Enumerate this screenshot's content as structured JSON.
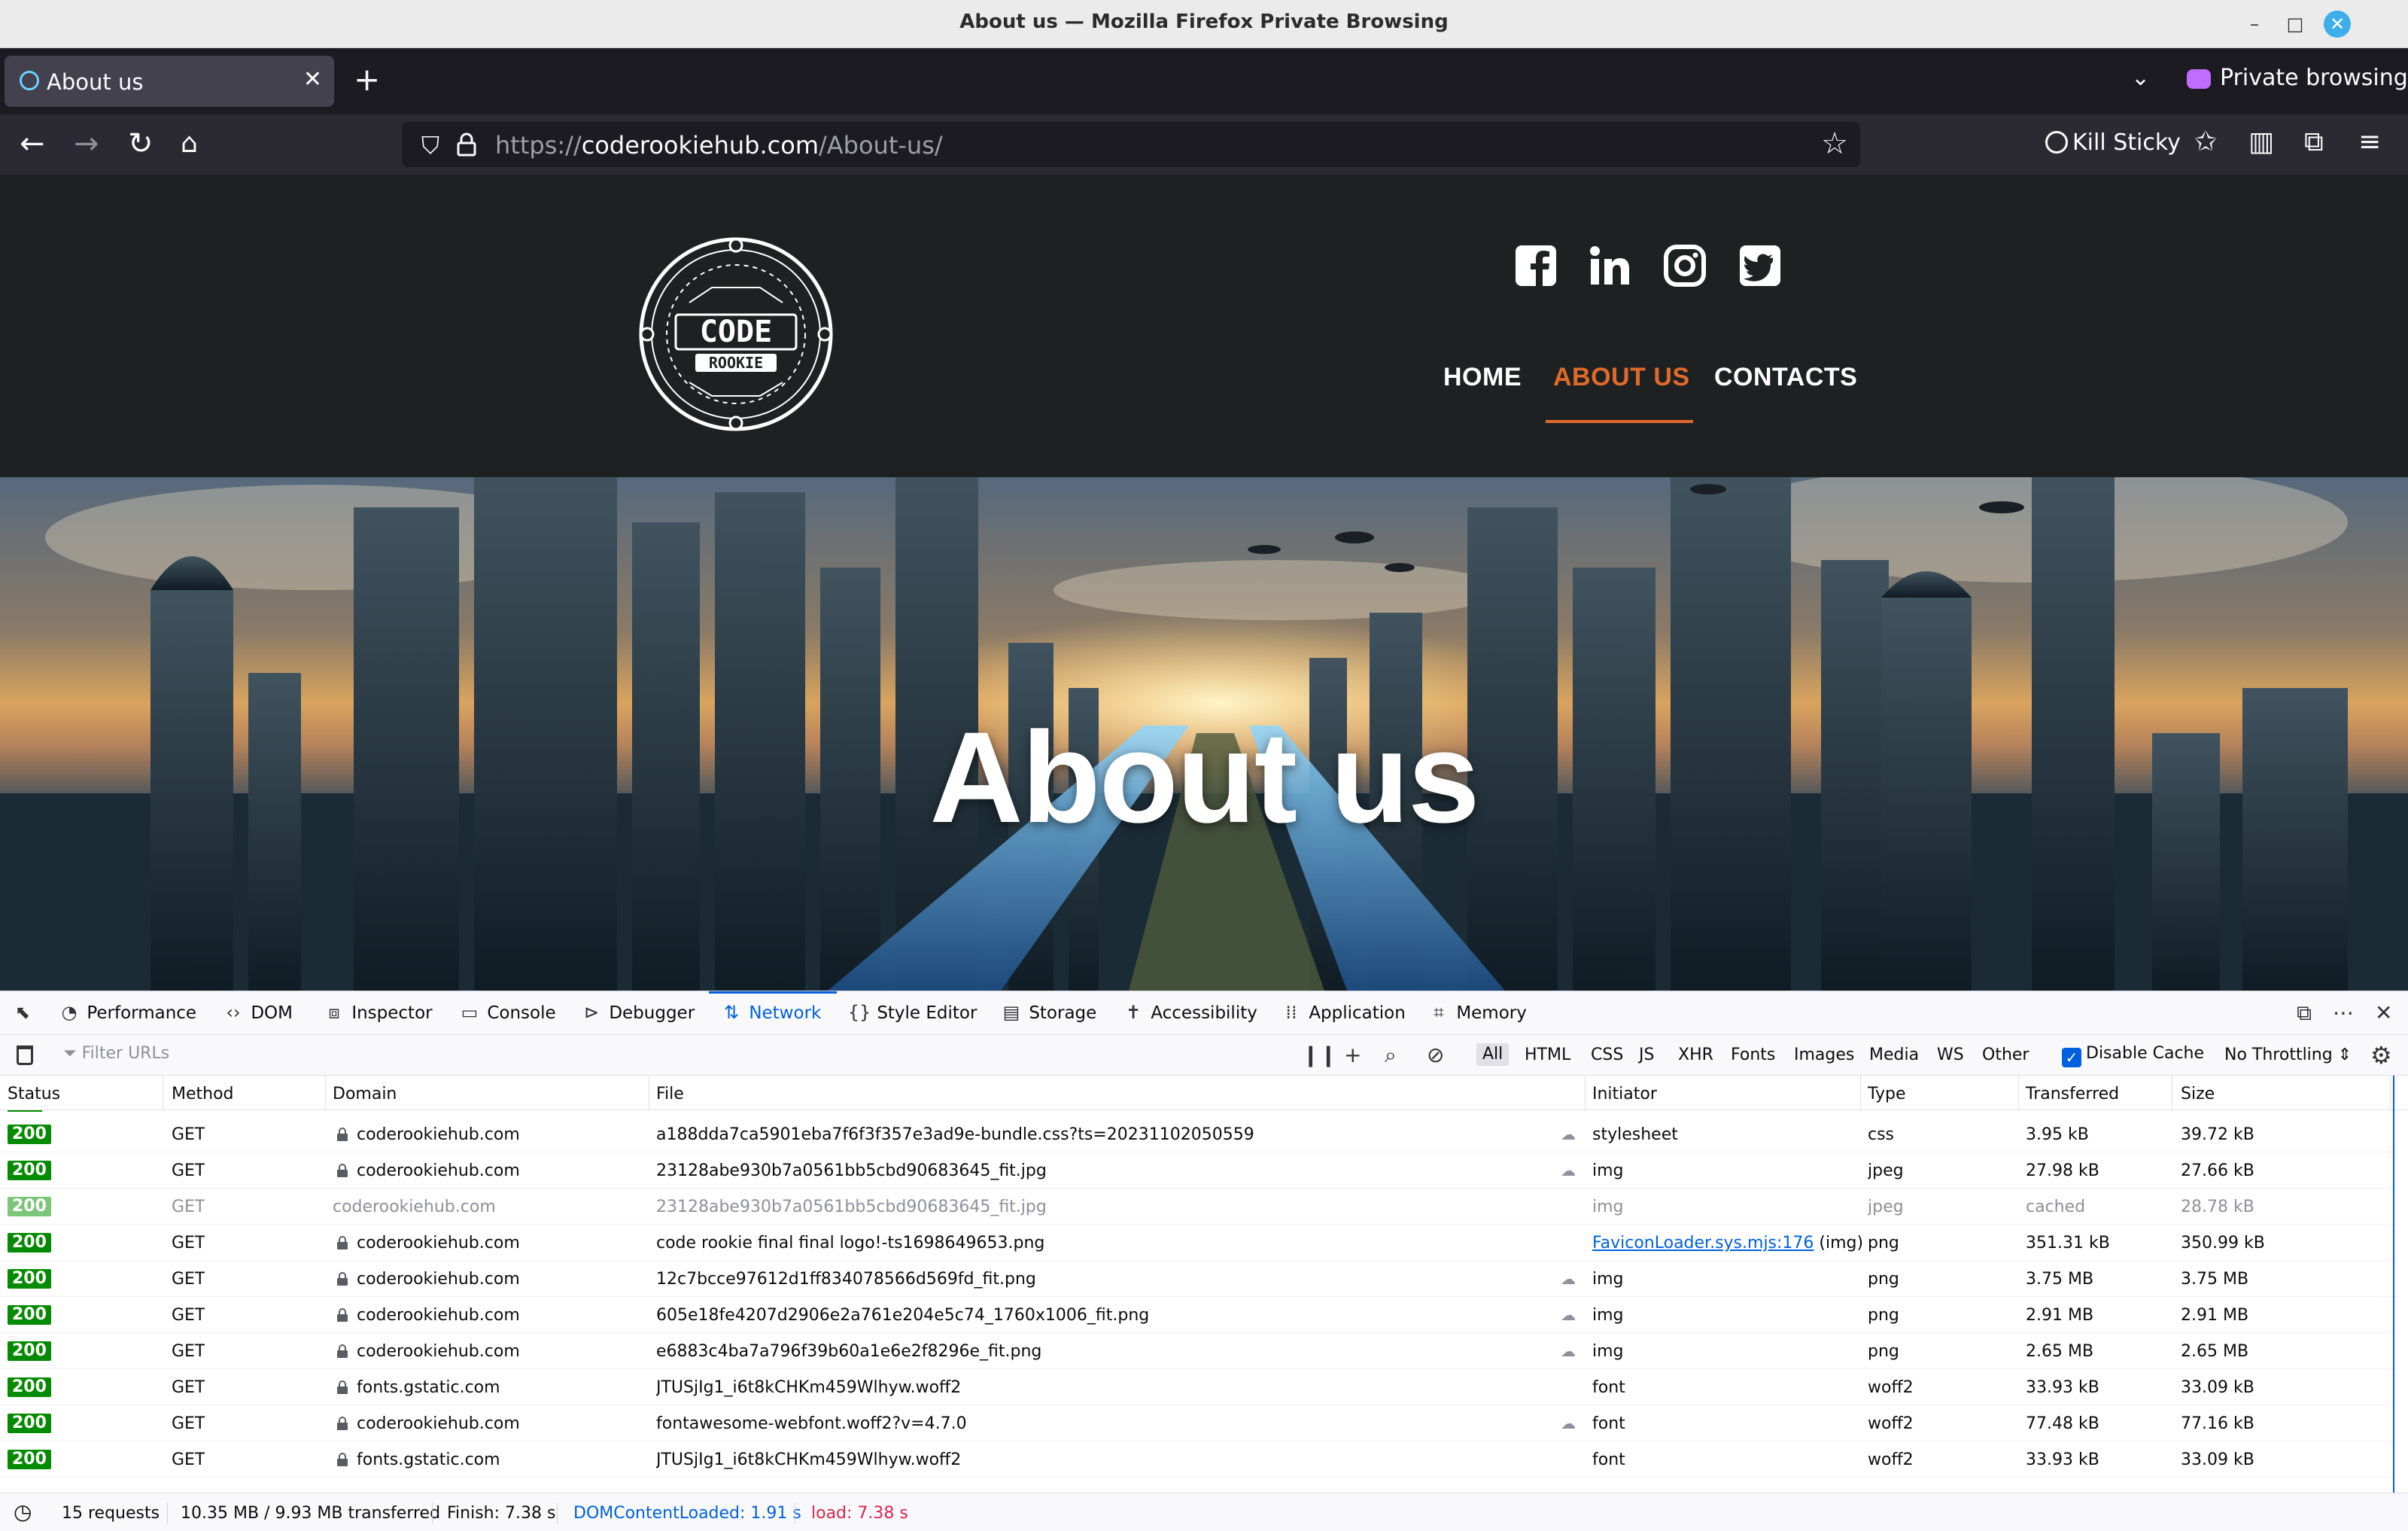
{
  "window": {
    "title": "About us — Mozilla Firefox Private Browsing"
  },
  "tabs": [
    {
      "label": "About us",
      "active": true
    }
  ],
  "toolbar": {
    "private_label": "Private browsing",
    "kill_sticky_label": "Kill Sticky"
  },
  "urlbar": {
    "scheme": "https://",
    "host": "coderookiehub.com",
    "path": "/About-us/"
  },
  "site": {
    "logo_text": "CODE ROOKIE",
    "nav": [
      {
        "label": "HOME",
        "active": false
      },
      {
        "label": "ABOUT US",
        "active": true
      },
      {
        "label": "CONTACTS",
        "active": false
      }
    ],
    "social_icons": [
      "facebook-icon",
      "linkedin-icon",
      "instagram-icon",
      "twitter-icon"
    ],
    "hero_title": "About us",
    "accent_color": "#e06a2b"
  },
  "devtools": {
    "tabs": [
      "Performance",
      "DOM",
      "Inspector",
      "Console",
      "Debugger",
      "Network",
      "Style Editor",
      "Storage",
      "Accessibility",
      "Application",
      "Memory"
    ],
    "active_tab": "Network",
    "filter_placeholder": "Filter URLs",
    "filter_types": [
      "All",
      "HTML",
      "CSS",
      "JS",
      "XHR",
      "Fonts",
      "Images",
      "Media",
      "WS",
      "Other"
    ],
    "disable_cache_label": "Disable Cache",
    "disable_cache_checked": true,
    "throttling_label": "No Throttling",
    "columns": [
      "Status",
      "Method",
      "Domain",
      "File",
      "Initiator",
      "Type",
      "Transferred",
      "Size"
    ],
    "rows": [
      {
        "status": "200",
        "method": "GET",
        "domain": "coderookiehub.com",
        "secure": true,
        "file": "a188dda7ca5901eba7f6f3f357e3ad9e-bundle.css?ts=20231102050559",
        "tracker": true,
        "initiator": "stylesheet",
        "type": "css",
        "transferred": "3.95 kB",
        "size": "39.72 kB",
        "cached": false
      },
      {
        "status": "200",
        "method": "GET",
        "domain": "coderookiehub.com",
        "secure": true,
        "file": "23128abe930b7a0561bb5cbd90683645_fit.jpg",
        "tracker": true,
        "initiator": "img",
        "type": "jpeg",
        "transferred": "27.98 kB",
        "size": "27.66 kB",
        "cached": false
      },
      {
        "status": "200",
        "method": "GET",
        "domain": "coderookiehub.com",
        "secure": false,
        "file": "23128abe930b7a0561bb5cbd90683645_fit.jpg",
        "tracker": false,
        "initiator": "img",
        "type": "jpeg",
        "transferred": "cached",
        "size": "28.78 kB",
        "cached": true
      },
      {
        "status": "200",
        "method": "GET",
        "domain": "coderookiehub.com",
        "secure": true,
        "file": "code rookie final final logo!-ts1698649653.png",
        "tracker": false,
        "initiator": "FaviconLoader.sys.mjs:176",
        "initiator_suffix": "(img)",
        "type": "png",
        "transferred": "351.31 kB",
        "size": "350.99 kB",
        "cached": false
      },
      {
        "status": "200",
        "method": "GET",
        "domain": "coderookiehub.com",
        "secure": true,
        "file": "12c7bcce97612d1ff834078566d569fd_fit.png",
        "tracker": true,
        "initiator": "img",
        "type": "png",
        "transferred": "3.75 MB",
        "size": "3.75 MB",
        "cached": false
      },
      {
        "status": "200",
        "method": "GET",
        "domain": "coderookiehub.com",
        "secure": true,
        "file": "605e18fe4207d2906e2a761e204e5c74_1760x1006_fit.png",
        "tracker": true,
        "initiator": "img",
        "type": "png",
        "transferred": "2.91 MB",
        "size": "2.91 MB",
        "cached": false
      },
      {
        "status": "200",
        "method": "GET",
        "domain": "coderookiehub.com",
        "secure": true,
        "file": "e6883c4ba7a796f39b60a1e6e2f8296e_fit.png",
        "tracker": true,
        "initiator": "img",
        "type": "png",
        "transferred": "2.65 MB",
        "size": "2.65 MB",
        "cached": false
      },
      {
        "status": "200",
        "method": "GET",
        "domain": "fonts.gstatic.com",
        "secure": true,
        "file": "JTUSjIg1_i6t8kCHKm459Wlhyw.woff2",
        "tracker": false,
        "initiator": "font",
        "type": "woff2",
        "transferred": "33.93 kB",
        "size": "33.09 kB",
        "cached": false
      },
      {
        "status": "200",
        "method": "GET",
        "domain": "coderookiehub.com",
        "secure": true,
        "file": "fontawesome-webfont.woff2?v=4.7.0",
        "tracker": true,
        "initiator": "font",
        "type": "woff2",
        "transferred": "77.48 kB",
        "size": "77.16 kB",
        "cached": false
      },
      {
        "status": "200",
        "method": "GET",
        "domain": "fonts.gstatic.com",
        "secure": true,
        "file": "JTUSjIg1_i6t8kCHKm459Wlhyw.woff2",
        "tracker": false,
        "initiator": "font",
        "type": "woff2",
        "transferred": "33.93 kB",
        "size": "33.09 kB",
        "cached": false
      }
    ],
    "summary": {
      "requests": "15 requests",
      "transferred": "10.35 MB / 9.93 MB transferred",
      "finish": "Finish: 7.38 s",
      "dom_content_loaded": "DOMContentLoaded: 1.91 s",
      "load": "load: 7.38 s"
    }
  }
}
